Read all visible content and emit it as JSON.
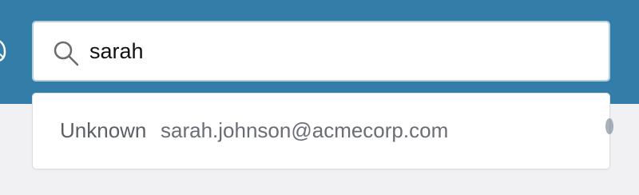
{
  "search": {
    "value": "sarah",
    "icon": "search-icon"
  },
  "suggestions": [
    {
      "name": "Unknown",
      "email": "sarah.johnson@acmecorp.com"
    }
  ],
  "colors": {
    "header_background": "#337ea9",
    "page_background": "#f1f1f4",
    "input_border": "#b5cfdf",
    "suggestion_text": "#6a6d75"
  }
}
